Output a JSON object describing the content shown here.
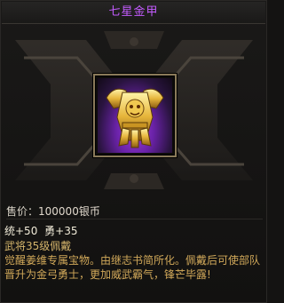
{
  "tooltip": {
    "title": "七星金甲",
    "item_icon": "golden-armor-icon",
    "price_label": "售价：",
    "price_value": "100000银币",
    "stats": [
      "统+50",
      "勇+35"
    ],
    "requirement": "武将35级佩戴",
    "description": "觉醒姜维专属宝物。由继志书简所化。佩戴后可使部队晋升为金弓勇士，更加威武霸气，锋芒毕露!"
  },
  "colors": {
    "title": "#c45cff",
    "stats": "#f0ead8",
    "requirement": "#d4b46b",
    "description": "#d2a95a",
    "price": "#e0d8cc"
  }
}
